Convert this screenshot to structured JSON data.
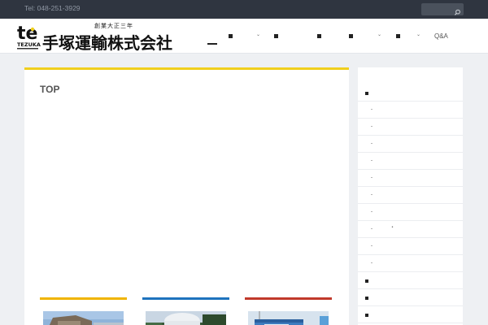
{
  "topbar": {
    "tel": "Tel: 048-251-3929",
    "search_placeholder": ""
  },
  "header": {
    "logo_mark_text": "te",
    "logo_mark_sub": "TEZUKA",
    "logo_tagline": "創業大正三年",
    "logo_company": "手塚運輸株式会社"
  },
  "nav": {
    "qa_label": "Q&A"
  },
  "main": {
    "page_title": "TOP"
  },
  "cards": [
    {
      "bar_color": "#f0b400"
    },
    {
      "bar_color": "#1e73be"
    },
    {
      "bar_color": "#c0392b"
    }
  ],
  "colors": {
    "topbar_bg": "#2f3540",
    "accent_yellow": "#f0cf1d",
    "page_bg": "#eef0f3"
  },
  "icons": {
    "search": "search-icon"
  }
}
